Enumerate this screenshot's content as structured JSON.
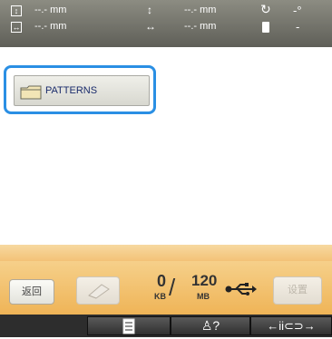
{
  "status": {
    "height_value": "--.- mm",
    "width_value": "--.- mm",
    "vertical_offset_value": "--.- mm",
    "horizontal_offset_value": "--.- mm",
    "rotation_value": "-°",
    "thread_value": "-"
  },
  "file_list": {
    "folder_label": "PATTERNS"
  },
  "bottom": {
    "back_label": "返回",
    "used_value": "0",
    "used_unit": "KB",
    "slash": "/",
    "total_value": "120",
    "total_unit": "MB",
    "settings_label": "设置"
  },
  "colors": {
    "status_bar": "#6f6f67",
    "selection_border": "#2a8fe4",
    "bottom_panel": "#f3c277",
    "bottom_bar": "#2d2d2d"
  }
}
